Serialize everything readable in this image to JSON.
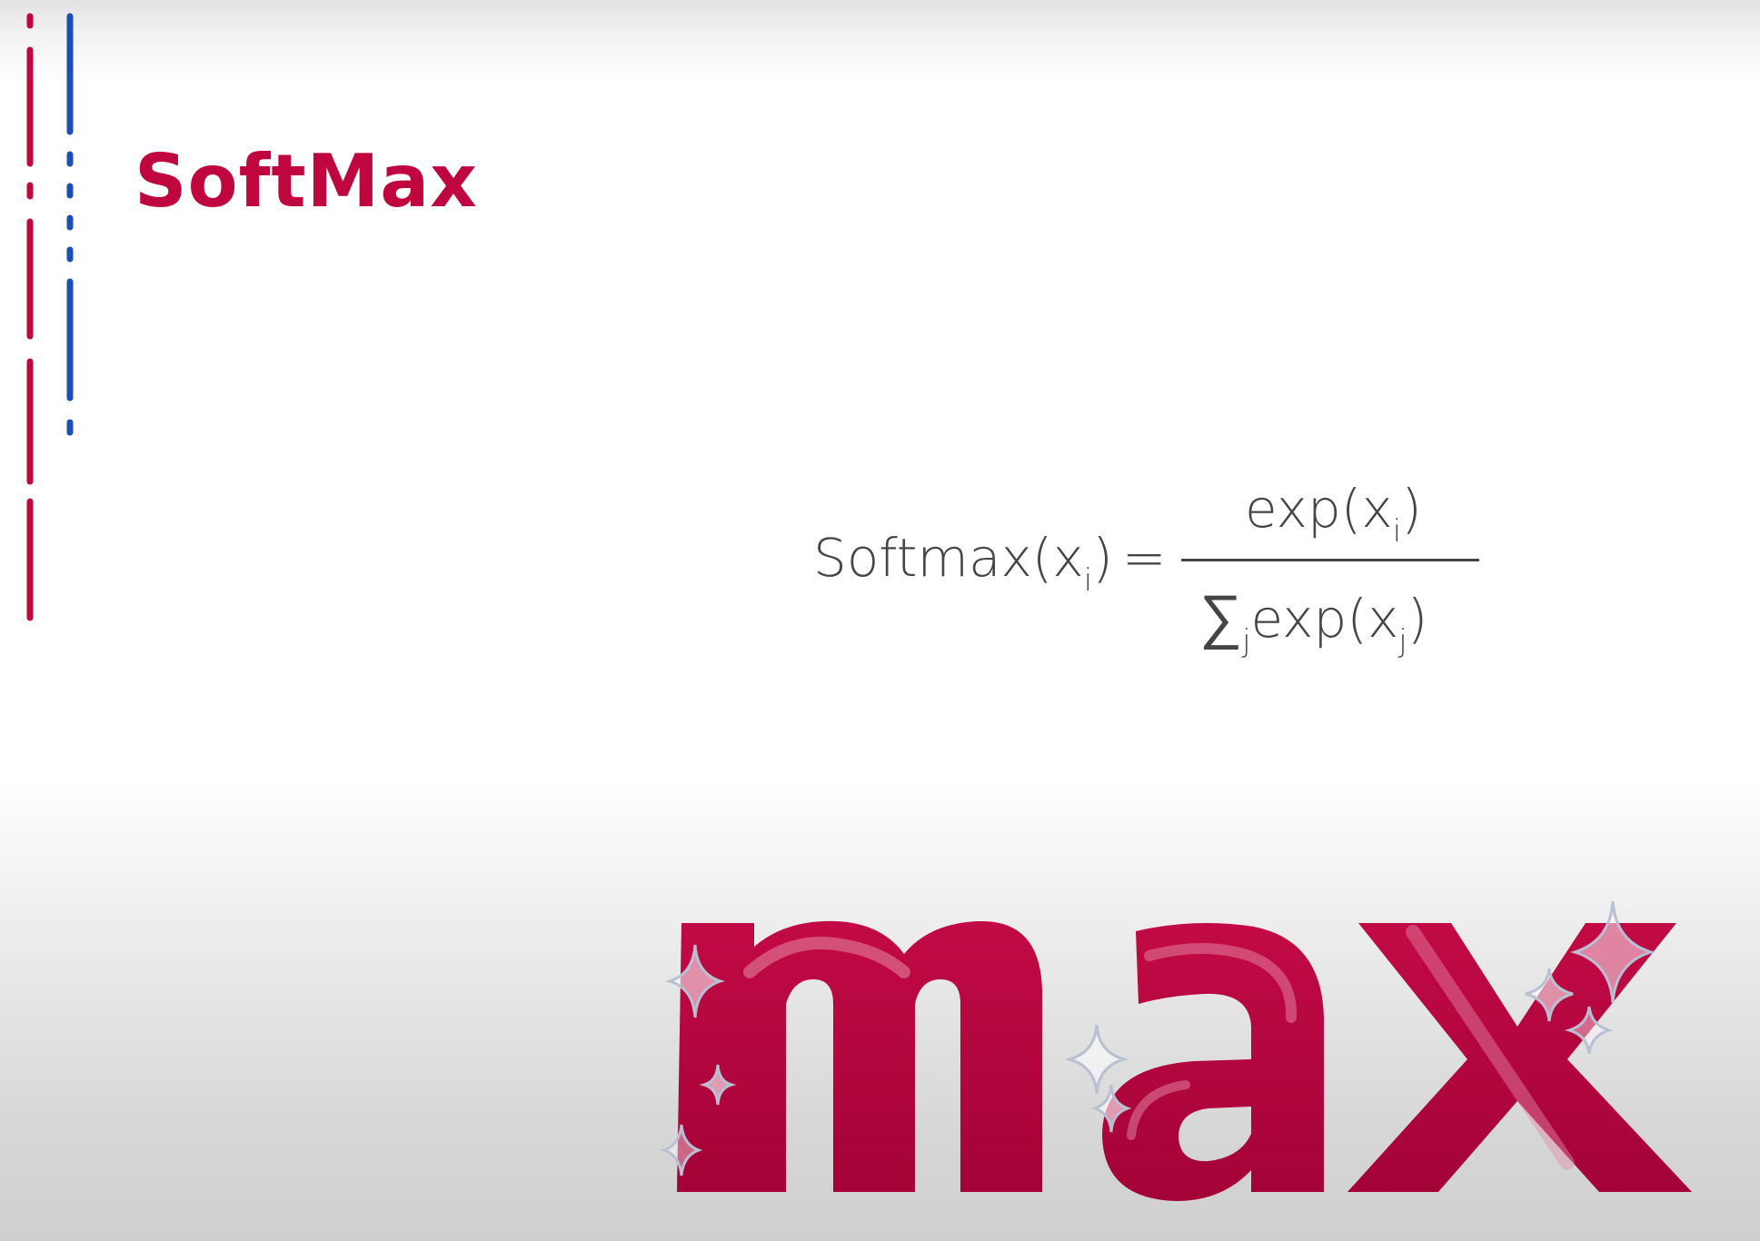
{
  "slide": {
    "title": "SoftMax",
    "accent_color": "#c0063f",
    "secondary_color": "#1b4fb3"
  },
  "formula": {
    "lhs_function": "Softmax(x",
    "lhs_subscript": "i",
    "lhs_close": ")",
    "equals": "=",
    "numerator_function": "exp(x",
    "numerator_subscript": "i",
    "numerator_close": ")",
    "denominator_sigma": "∑",
    "denominator_sigma_subscript": "j",
    "denominator_function": "exp(x",
    "denominator_subscript": "j",
    "denominator_close": ")"
  },
  "illustration": {
    "word": "max",
    "color": "#b0053c",
    "sparkle_icon": "sparkle-icon"
  }
}
